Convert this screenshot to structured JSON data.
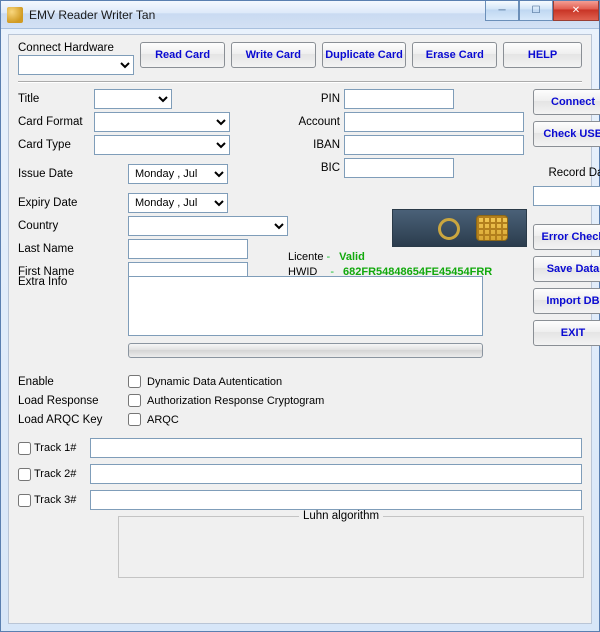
{
  "window": {
    "title": "EMV Reader Writer Tan"
  },
  "toolbar": {
    "connect_hw": "Connect Hardware",
    "read": "Read Card",
    "write": "Write Card",
    "dup": "Duplicate Card",
    "erase": "Erase Card",
    "help": "HELP"
  },
  "labels": {
    "title": "Title",
    "cardformat": "Card Format",
    "cardtype": "Card Type",
    "issuedate": "Issue Date",
    "expiry": "Expiry Date",
    "country": "Country",
    "lastname": "Last Name",
    "firstname": "First Name",
    "extra": "Extra Info",
    "pin": "PIN",
    "account": "Account",
    "iban": "IBAN",
    "bic": "BIC",
    "licente": "Licente",
    "hwid": "HWID",
    "recorddate": "Record Date",
    "enable": "Enable",
    "loadresp": "Load Response",
    "loadarqc": "Load ARQC Key",
    "dda": "Dynamic Data Autentication",
    "arc": "Authorization Response Cryptogram",
    "arqc": "ARQC",
    "track1": "Track 1#",
    "track2": "Track 2#",
    "track3": "Track 3#",
    "luhn": "Luhn algorithm"
  },
  "side": {
    "connect": "Connect",
    "checkusb": "Check USB",
    "errchk": "Error Check",
    "save": "Save Data",
    "import": "Import DB",
    "exit": "EXIT"
  },
  "values": {
    "hardware_sel": "",
    "title_sel": "",
    "cardformat_sel": "",
    "cardtype_sel": "",
    "issue_day": "Monday",
    "issue_mon": "Jul",
    "expiry_day": "Monday",
    "expiry_mon": "Jul",
    "country_sel": "",
    "lastname": "",
    "firstname": "",
    "extra": "",
    "pin": "",
    "account": "",
    "iban": "",
    "bic": "",
    "lic_status": "Valid",
    "hwid": "682FR54848654FE45454FRR",
    "recorddate": "",
    "track1": "",
    "track2": "",
    "track3": ""
  }
}
